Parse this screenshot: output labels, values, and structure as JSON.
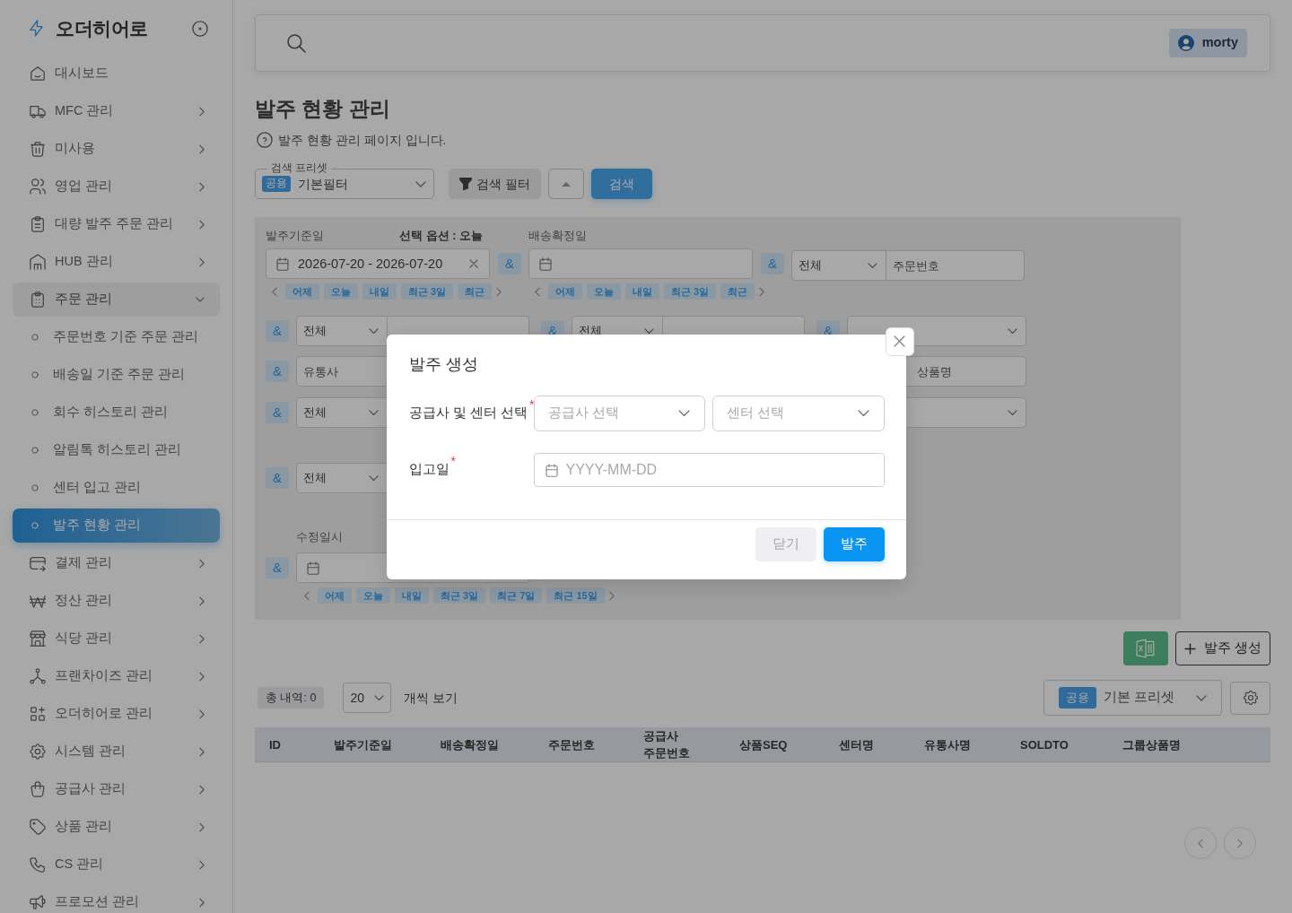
{
  "sidebar": {
    "brand": "오더히어로",
    "items": [
      {
        "label": "대시보드",
        "kind": "link",
        "selected": false
      },
      {
        "label": "MFC 관리",
        "kind": "group",
        "expanded": false,
        "selected": false
      },
      {
        "label": "미사용",
        "kind": "group",
        "expanded": false,
        "selected": false
      },
      {
        "label": "영업 관리",
        "kind": "group",
        "expanded": false,
        "selected": false
      },
      {
        "label": "대량 발주 주문 관리",
        "kind": "group",
        "expanded": false,
        "selected": false
      },
      {
        "label": "HUB 관리",
        "kind": "group",
        "expanded": false,
        "selected": false
      },
      {
        "label": "주문 관리",
        "kind": "group",
        "expanded": true,
        "selected": false,
        "children": [
          {
            "label": "주문번호 기준 주문 관리",
            "selected": false
          },
          {
            "label": "배송일 기준 주문 관리",
            "selected": false
          },
          {
            "label": "회수 히스토리 관리",
            "selected": false
          },
          {
            "label": "알림톡 히스토리 관리",
            "selected": false
          },
          {
            "label": "센터 입고 관리",
            "selected": false
          },
          {
            "label": "발주 현황 관리",
            "selected": true
          }
        ]
      },
      {
        "label": "결제 관리",
        "kind": "group",
        "expanded": false,
        "selected": false
      },
      {
        "label": "정산 관리",
        "kind": "group",
        "expanded": false,
        "selected": false
      },
      {
        "label": "식당 관리",
        "kind": "group",
        "expanded": false,
        "selected": false
      },
      {
        "label": "프랜차이즈 관리",
        "kind": "group",
        "expanded": false,
        "selected": false
      },
      {
        "label": "오더히어로 관리",
        "kind": "group",
        "expanded": false,
        "selected": false
      },
      {
        "label": "시스템 관리",
        "kind": "group",
        "expanded": false,
        "selected": false
      },
      {
        "label": "공급사 관리",
        "kind": "group",
        "expanded": false,
        "selected": false
      },
      {
        "label": "상품 관리",
        "kind": "group",
        "expanded": false,
        "selected": false
      },
      {
        "label": "CS 관리",
        "kind": "group",
        "expanded": false,
        "selected": false
      },
      {
        "label": "프로모션 관리",
        "kind": "group",
        "expanded": false,
        "selected": false
      }
    ]
  },
  "header": {
    "user": "morty"
  },
  "page": {
    "title": "발주 현황 관리",
    "description": "발주 현황 관리 페이지 입니다."
  },
  "toolbar": {
    "preset": {
      "legend": "검색 프리셋",
      "badge": "공용",
      "value": "기본필터"
    },
    "filter_button": "검색 필터",
    "search_button": "검색"
  },
  "filter_panel": {
    "expanded": true,
    "date_filters": [
      {
        "label": "발주기준일",
        "option": "선택 옵션 : 오늘",
        "value": "2026-07-20 - 2026-07-20",
        "operator": "&",
        "chips": [
          "어제",
          "오늘",
          "내일",
          "최근 3일",
          "최근"
        ]
      },
      {
        "label": "배송확정일",
        "operator": "&",
        "chips": [
          "어제",
          "오늘",
          "내일",
          "최근 3일",
          "최근"
        ]
      }
    ],
    "keyword": {
      "select": "전체",
      "placeholder": "주문번호"
    },
    "rows": [
      {
        "left": {
          "kind": "select_input",
          "operator": "&",
          "select": "전체"
        },
        "middle": {
          "kind": "select_input",
          "operator": "&",
          "select": "전체"
        },
        "right": {
          "kind": "select",
          "operator": "&"
        }
      },
      {
        "left": {
          "kind": "input",
          "operator": "&",
          "placeholder": "유통사"
        },
        "right": {
          "kind": "input",
          "placeholder": "상품명"
        }
      },
      {
        "left": {
          "kind": "select_input",
          "operator": "&",
          "select": "전체"
        },
        "right": {
          "kind": "select"
        }
      },
      {
        "left": {
          "kind": "select_input",
          "operator": "&",
          "select": "전체"
        }
      },
      {
        "left": {
          "kind": "date",
          "operator": "&",
          "label": "수정일시",
          "chips": [
            "어제",
            "오늘",
            "내일",
            "최근 3일",
            "최근 7일",
            "최근 15일"
          ]
        }
      }
    ]
  },
  "actions": {
    "create_button": "발주 생성"
  },
  "list_controls": {
    "total": "총 내역: 0",
    "page_size": "20",
    "page_size_suffix": "개씩 보기",
    "preset": {
      "badge": "공용",
      "value": "기본 프리셋"
    }
  },
  "table": {
    "columns": [
      "ID",
      "발주기준일",
      "배송확정일",
      "주문번호",
      "공급사\n주문번호",
      "상품SEQ",
      "센터명",
      "유통사명",
      "SOLDTO",
      "그룹상품명"
    ]
  },
  "modal": {
    "title": "발주 생성",
    "fields": [
      {
        "kind": "selects",
        "label": "공급사 및 센터 선택",
        "required_mark": "*",
        "selects": [
          {
            "placeholder": "공급사 선택"
          },
          {
            "placeholder": "센터 선택"
          }
        ]
      },
      {
        "kind": "date",
        "label": "입고일",
        "required_mark": "*",
        "placeholder": "YYYY-MM-DD"
      }
    ],
    "buttons": [
      {
        "label": "닫기",
        "kind": "secondary"
      },
      {
        "label": "발주",
        "kind": "primary"
      }
    ]
  }
}
